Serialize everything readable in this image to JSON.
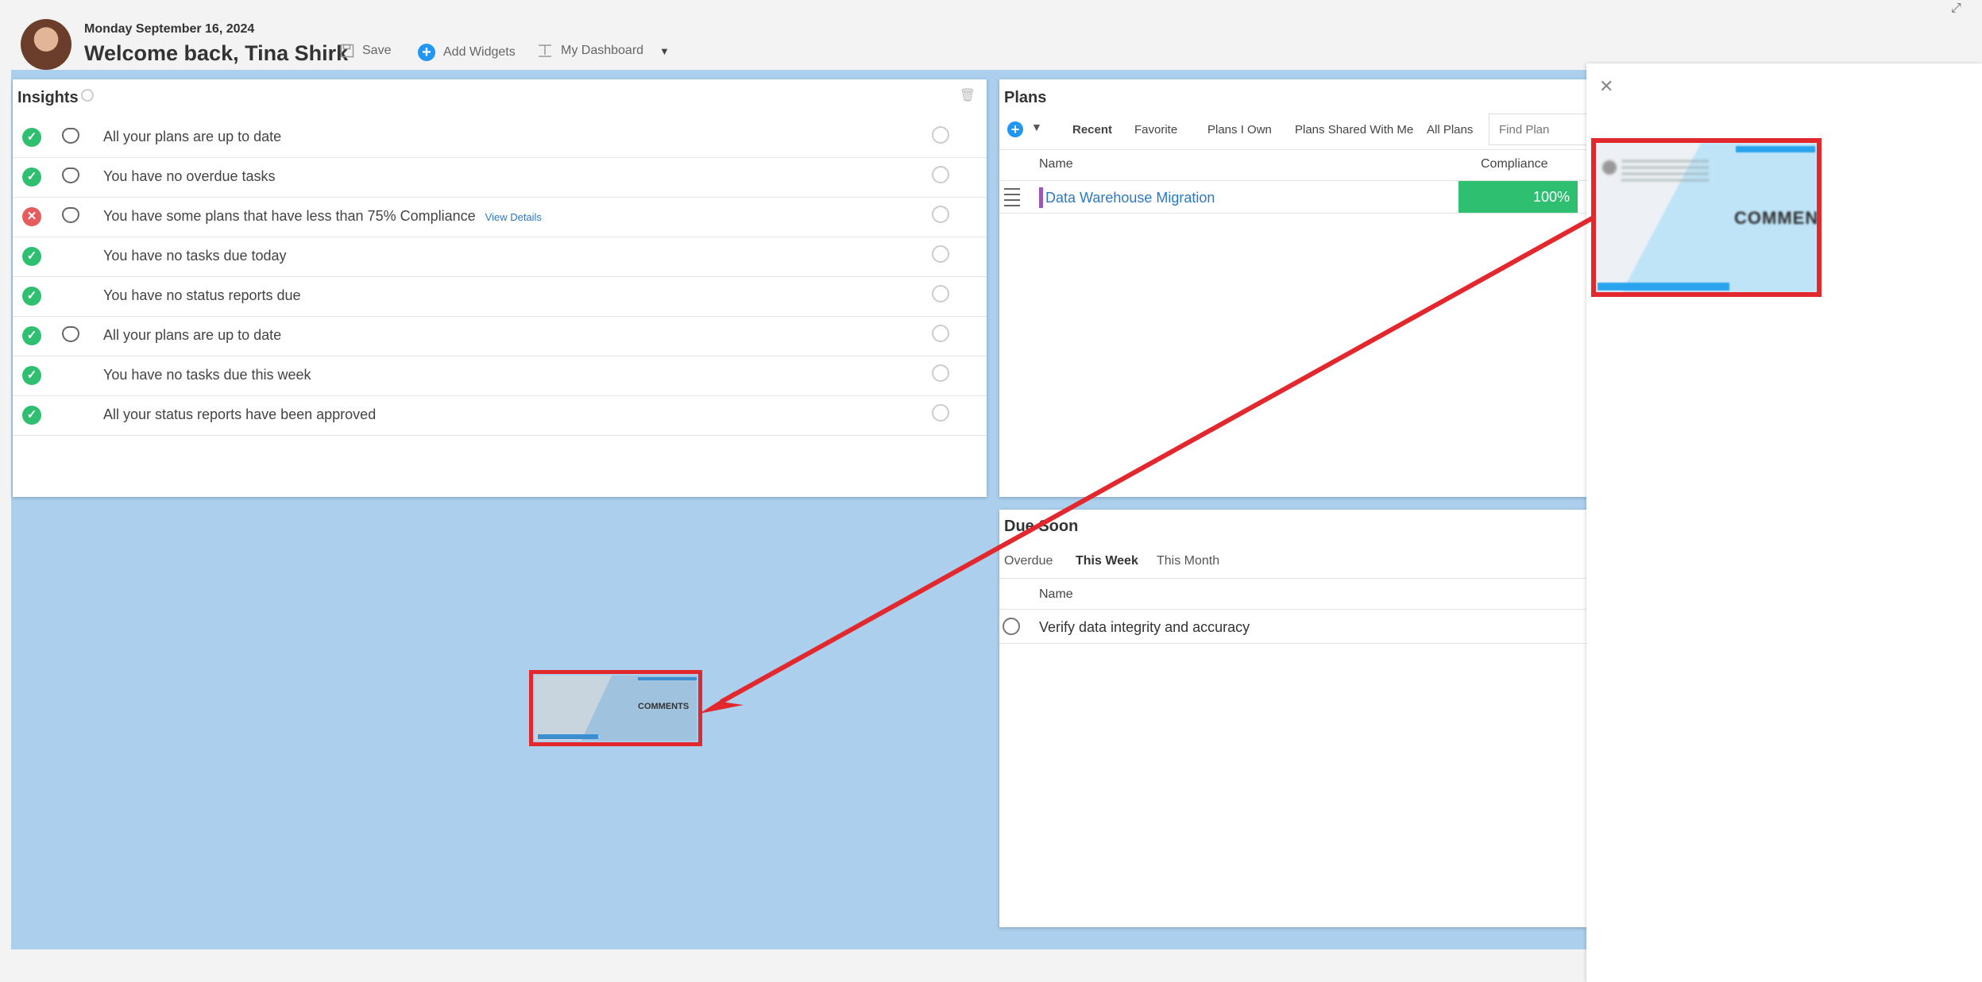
{
  "header": {
    "date": "Monday September 16, 2024",
    "welcome": "Welcome back, Tina Shirk",
    "save_label": "Save",
    "add_widgets_label": "Add Widgets",
    "dashboard_label": "My Dashboard"
  },
  "insights": {
    "title": "Insights",
    "rows": [
      {
        "status": "ok",
        "badge": true,
        "text": "All your plans are up to date"
      },
      {
        "status": "ok",
        "badge": true,
        "text": "You have no overdue tasks"
      },
      {
        "status": "bad",
        "badge": true,
        "text": "You have some plans that have less than 75% Compliance",
        "link": "View Details"
      },
      {
        "status": "ok",
        "badge": false,
        "text": "You have no tasks due today"
      },
      {
        "status": "ok",
        "badge": false,
        "text": "You have no status reports due"
      },
      {
        "status": "ok",
        "badge": true,
        "text": "All your plans are up to date"
      },
      {
        "status": "ok",
        "badge": false,
        "text": "You have no tasks due this week"
      },
      {
        "status": "ok",
        "badge": false,
        "text": "All your status reports have been approved"
      }
    ]
  },
  "plans": {
    "title": "Plans",
    "tabs": [
      "Recent",
      "Favorite",
      "Plans I Own",
      "Plans Shared With Me",
      "All Plans"
    ],
    "active_tab": "Recent",
    "search_placeholder": "Find Plan",
    "columns": {
      "name": "Name",
      "compliance": "Compliance"
    },
    "rows": [
      {
        "name": "Data Warehouse Migration",
        "compliance": "100%",
        "color": "#9b59b6"
      }
    ]
  },
  "due_soon": {
    "title": "Due Soon",
    "tabs": [
      "Overdue",
      "This Week",
      "This Month"
    ],
    "active_tab": "This Week",
    "column_name": "Name",
    "tasks": [
      "Verify data integrity and accuracy"
    ]
  },
  "thumbnail": {
    "label": "COMMENTS"
  },
  "flyout": {
    "preview_label": "COMMENTS"
  },
  "colors": {
    "canvas": "#abcfec",
    "success": "#2fbf71",
    "danger": "#e65b5b",
    "link": "#2b78c5",
    "annotation_red": "#e2272d"
  },
  "icons": {
    "close": "close-icon",
    "expand": "expand-icon",
    "trash": "trash-icon",
    "alarm": "alarm-clock-icon",
    "plus": "plus-circle-icon"
  }
}
